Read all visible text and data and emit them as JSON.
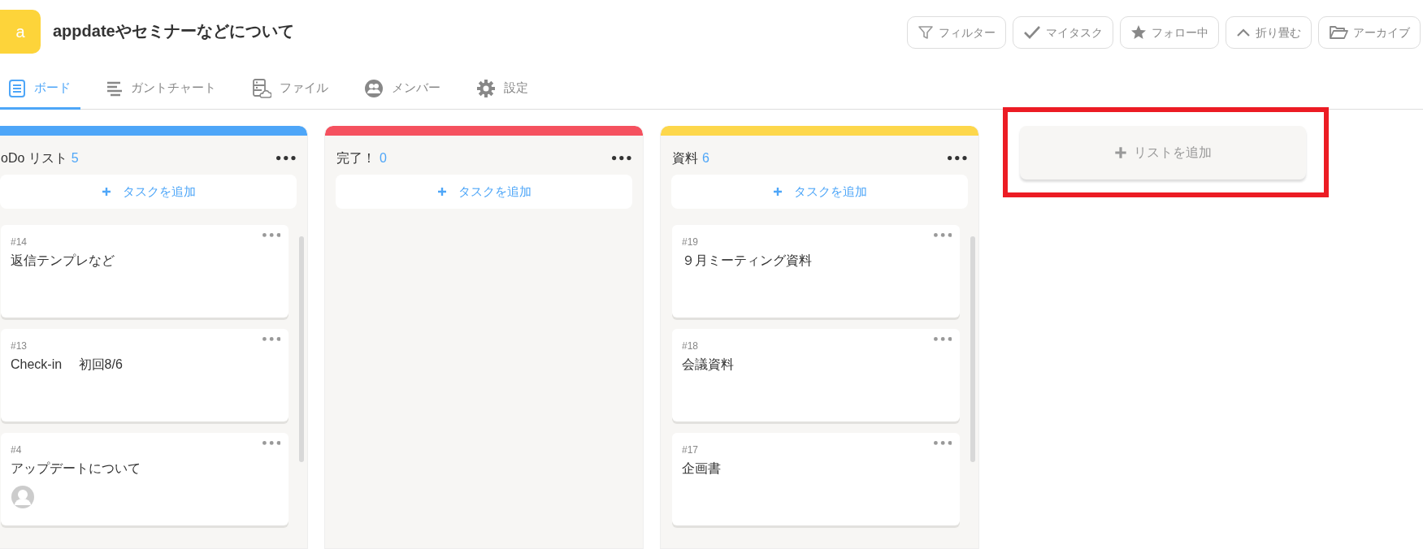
{
  "project": {
    "logo_letter": "a",
    "title": "appdateやセミナーなどについて"
  },
  "toolbar": [
    {
      "kind": "filter",
      "label": "フィルター"
    },
    {
      "kind": "check",
      "label": "マイタスク"
    },
    {
      "kind": "star",
      "label": "フォロー中"
    },
    {
      "kind": "collapse",
      "label": "折り畳む"
    },
    {
      "kind": "folder",
      "label": "アーカイブ"
    }
  ],
  "tabs": [
    {
      "kind": "board",
      "label": "ボード",
      "selected": true
    },
    {
      "kind": "gantt",
      "label": "ガントチャート",
      "selected": false
    },
    {
      "kind": "file",
      "label": "ファイル",
      "selected": false
    },
    {
      "kind": "member",
      "label": "メンバー",
      "selected": false
    },
    {
      "kind": "settings",
      "label": "設定",
      "selected": false
    }
  ],
  "lists": [
    {
      "title": "oDo リスト",
      "count": "5",
      "color": "#4ea6f8",
      "add_task": "タスクを追加",
      "scrollbar": true,
      "cards": [
        {
          "number": "#14",
          "title": "返信テンプレなど",
          "avatar": false
        },
        {
          "number": "#13",
          "title": "Check-in　 初回8/6",
          "avatar": false
        },
        {
          "number": "#4",
          "title": "アップデートについて",
          "avatar": true
        }
      ]
    },
    {
      "title": "完了！",
      "count": "0",
      "color": "#f5515f",
      "add_task": "タスクを追加",
      "scrollbar": false
    },
    {
      "title": "資料",
      "count": "6",
      "color": "#fdd74b",
      "add_task": "タスクを追加",
      "scrollbar": true,
      "cards": [
        {
          "number": "#19",
          "title": "９月ミーティング資料",
          "avatar": false
        },
        {
          "number": "#18",
          "title": "会議資料",
          "avatar": false
        },
        {
          "number": "#17",
          "title": "企画書",
          "avatar": false
        }
      ]
    }
  ],
  "add_list": {
    "label": "リストを追加",
    "highlighted": true
  }
}
